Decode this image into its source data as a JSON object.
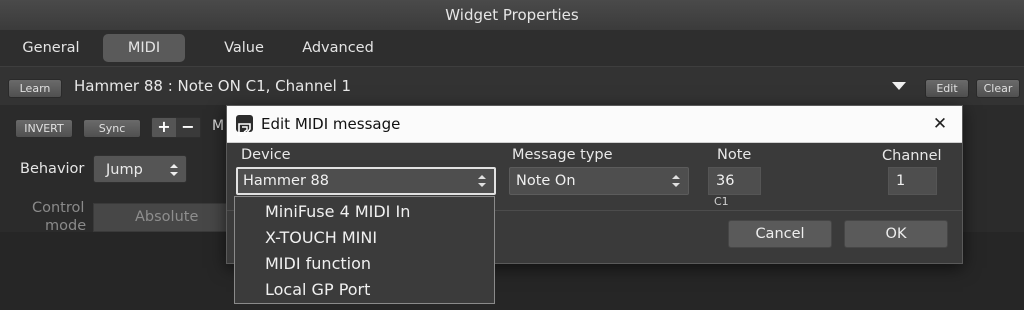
{
  "window": {
    "title": "Widget Properties"
  },
  "tabs": [
    {
      "label": "General"
    },
    {
      "label": "MIDI",
      "active": true
    },
    {
      "label": "Value"
    },
    {
      "label": "Advanced"
    }
  ],
  "learn_row": {
    "learn_label": "Learn",
    "binding_text": "Hammer 88 : Note ON C1, Channel 1",
    "edit_label": "Edit",
    "clear_label": "Clear"
  },
  "controls": {
    "invert_label": "INVERT",
    "sync_label": "Sync",
    "partial_label": "M",
    "behavior_label": "Behavior",
    "behavior_value": "Jump",
    "control_mode_label_1": "Control",
    "control_mode_label_2": "mode",
    "control_mode_value": "Absolute"
  },
  "dialog": {
    "title": "Edit MIDI message",
    "device_label": "Device",
    "device_value": "Hammer 88",
    "message_type_label": "Message type",
    "message_type_value": "Note On",
    "note_label": "Note",
    "note_value": "36",
    "note_name": "C1",
    "channel_label": "Channel",
    "channel_value": "1",
    "cancel_label": "Cancel",
    "ok_label": "OK"
  },
  "device_options": [
    "MiniFuse 4 MIDI In",
    "X-TOUCH MINI",
    "MIDI function",
    "Local GP Port"
  ],
  "colors": {
    "background": "#2b2b2b",
    "dialog_title_bg": "#fbfbfb",
    "accent_text": "#f0f0f0"
  }
}
